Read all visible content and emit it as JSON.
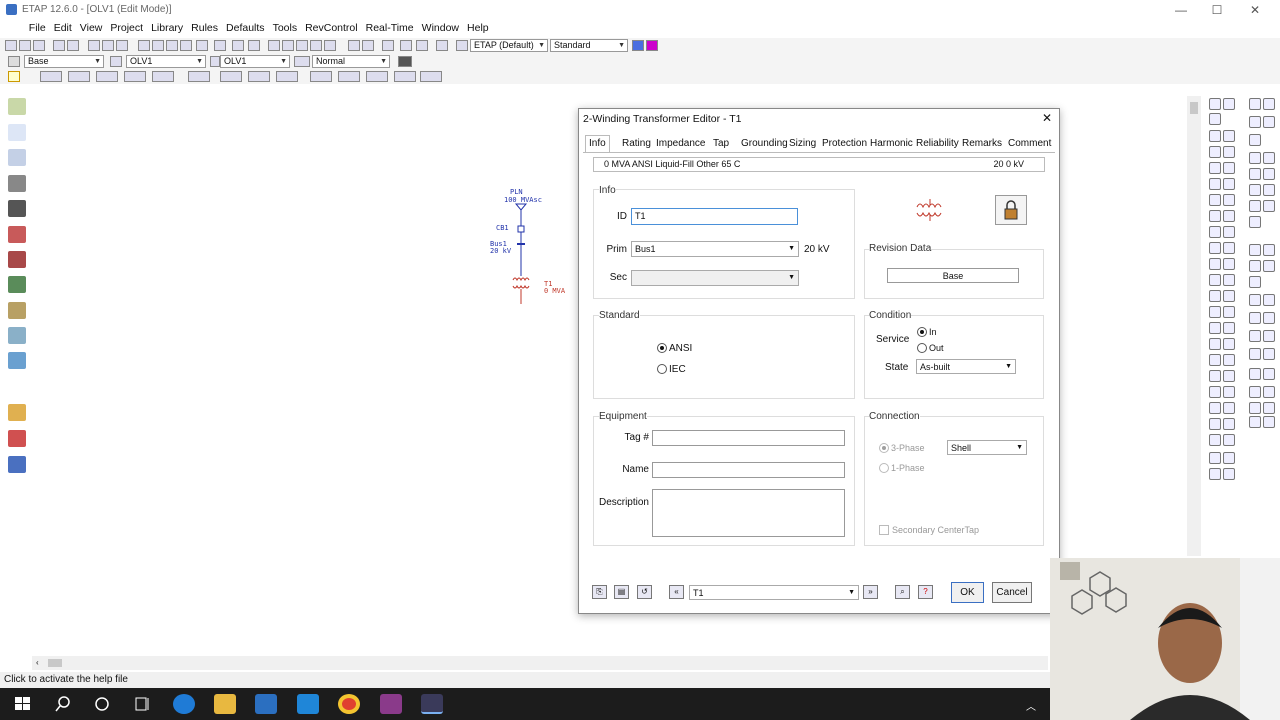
{
  "app": {
    "title": "ETAP 12.6.0 - [OLV1 (Edit Mode)]"
  },
  "window_controls": {
    "minimize": "—",
    "maximize": "☐",
    "close": "✕"
  },
  "menu": [
    "File",
    "Edit",
    "View",
    "Project",
    "Library",
    "Rules",
    "Defaults",
    "Tools",
    "RevControl",
    "Real-Time",
    "Window",
    "Help"
  ],
  "toolbar1": {
    "preset": "ETAP (Default)",
    "standard": "Standard"
  },
  "toolbar2": {
    "presentation": "Base",
    "oneline": "OLV1",
    "config": "OLV1",
    "mode": "Normal"
  },
  "oneline": {
    "pln_label": "PLN",
    "pln_mvasc": "100 MVAsc",
    "cb_label": "CB1",
    "bus_label": "Bus1",
    "bus_kv": "20 kV",
    "t_label": "T1",
    "t_mva": "0 MVA"
  },
  "dialog": {
    "title": "2-Winding Transformer Editor - T1",
    "tabs": [
      "Info",
      "Rating",
      "Impedance",
      "Tap",
      "Grounding",
      "Sizing",
      "Protection",
      "Harmonic",
      "Reliability",
      "Remarks",
      "Comment"
    ],
    "active_tab": "Info",
    "summary_left": "0 MVA  ANSI  Liquid-Fill  Other  65 C",
    "summary_right": "20  0 kV",
    "info": {
      "group_label": "Info",
      "id_label": "ID",
      "id_value": "T1",
      "prim_label": "Prim",
      "prim_value": "Bus1",
      "prim_kv": "20 kV",
      "sec_label": "Sec",
      "sec_value": ""
    },
    "revision": {
      "label": "Revision Data",
      "value": "Base"
    },
    "standard": {
      "label": "Standard",
      "options": [
        "ANSI",
        "IEC"
      ],
      "selected": "ANSI"
    },
    "condition": {
      "label": "Condition",
      "service_label": "Service",
      "service_options": [
        "In",
        "Out"
      ],
      "service_selected": "In",
      "state_label": "State",
      "state_value": "As-built"
    },
    "equipment": {
      "label": "Equipment",
      "tag_label": "Tag #",
      "name_label": "Name",
      "description_label": "Description",
      "tag_value": "",
      "name_value": "",
      "description_value": ""
    },
    "connection": {
      "label": "Connection",
      "phase_options": [
        "3-Phase",
        "1-Phase"
      ],
      "phase_selected": "3-Phase",
      "shell_value": "Shell",
      "centertap_label": "Secondary CenterTap"
    },
    "footer": {
      "element_value": "T1",
      "ok_label": "OK",
      "cancel_label": "Cancel"
    }
  },
  "status": {
    "text": "Click to activate the help file"
  },
  "colors": {
    "accent": "#3a6fc2",
    "oneline_blue": "#2233aa",
    "oneline_red": "#c0392b",
    "taskbar": "#1c1c1c"
  }
}
